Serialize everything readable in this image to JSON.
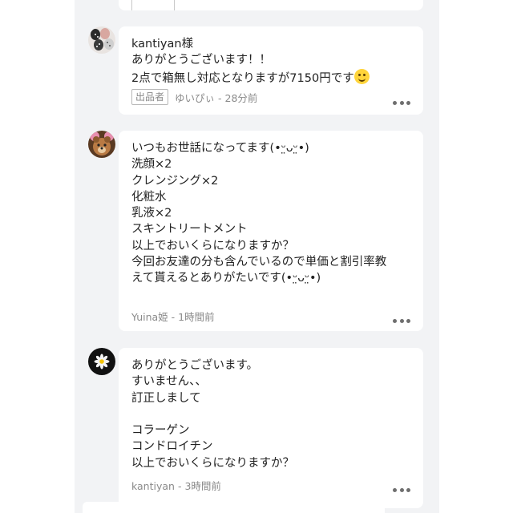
{
  "comments": [
    {
      "lines": [
        "kantiyan様",
        "ありがとうございます！！",
        "2点で箱無し対応となりますが7150円です"
      ],
      "emoji": "slightly-smiling-face-icon",
      "seller_badge": "出品者",
      "author": "ゆいぴぃ",
      "time": "28分前"
    },
    {
      "lines": [
        "いつもお世話になってます(•ᵕ̤ᴗᵕ̤•)",
        "洗顔×2",
        "クレンジング×2",
        "化粧水",
        "乳液×2",
        "スキントリートメント",
        "以上でおいくらになりますか？",
        "今回お友達の分も含んでいるので単価と割引率教",
        "えて貰えるとありがたいです(•ᵕ̤ᴗᵕ̤•)"
      ],
      "author": "Yuina姫",
      "time": "1時間前"
    },
    {
      "lines": [
        "ありがとうございます。",
        "すいません、、",
        "訂正しまして",
        "",
        "コラーゲン",
        "コンドロイチン",
        "以上でおいくらになりますか？"
      ],
      "author": "kantiyan",
      "time": "3時間前"
    }
  ],
  "meta_separator": " - ",
  "colors": {
    "panel_bg": "#f2f3f5",
    "card_bg": "#ffffff",
    "text": "#222222",
    "meta_text": "#8a8a8a"
  }
}
